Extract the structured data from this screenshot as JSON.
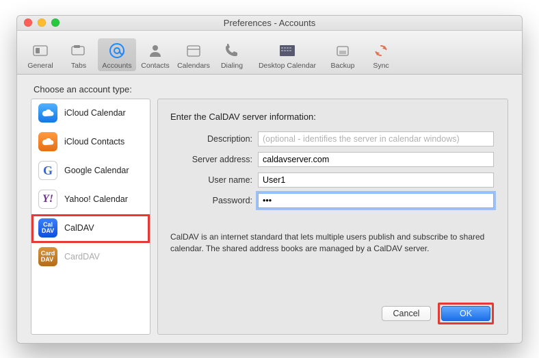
{
  "window": {
    "title": "Preferences - Accounts"
  },
  "toolbar": {
    "items": [
      {
        "label": "General"
      },
      {
        "label": "Tabs"
      },
      {
        "label": "Accounts"
      },
      {
        "label": "Contacts"
      },
      {
        "label": "Calendars"
      },
      {
        "label": "Dialing"
      },
      {
        "label": "Desktop Calendar"
      },
      {
        "label": "Backup"
      },
      {
        "label": "Sync"
      }
    ]
  },
  "section_title": "Choose an account type:",
  "account_types": {
    "items": [
      {
        "label": "iCloud Calendar"
      },
      {
        "label": "iCloud Contacts"
      },
      {
        "label": "Google Calendar"
      },
      {
        "label": "Yahoo! Calendar"
      },
      {
        "label": "CalDAV"
      },
      {
        "label": "CardDAV"
      }
    ],
    "selected_index": 4
  },
  "form": {
    "title": "Enter the CalDAV server information:",
    "description": {
      "label": "Description:",
      "placeholder": "(optional - identifies the server in calendar windows)",
      "value": ""
    },
    "server": {
      "label": "Server address:",
      "value": "caldavserver.com"
    },
    "username": {
      "label": "User name:",
      "value": "User1"
    },
    "password": {
      "label": "Password:",
      "value": "•••"
    }
  },
  "help_text": "CalDAV is an internet standard that lets multiple users publish and subscribe to shared calendar. The shared address books are managed by a CalDAV server.",
  "buttons": {
    "cancel": "Cancel",
    "ok": "OK"
  },
  "colors": {
    "highlight": "#e53935",
    "primary": "#1b6fe8"
  }
}
